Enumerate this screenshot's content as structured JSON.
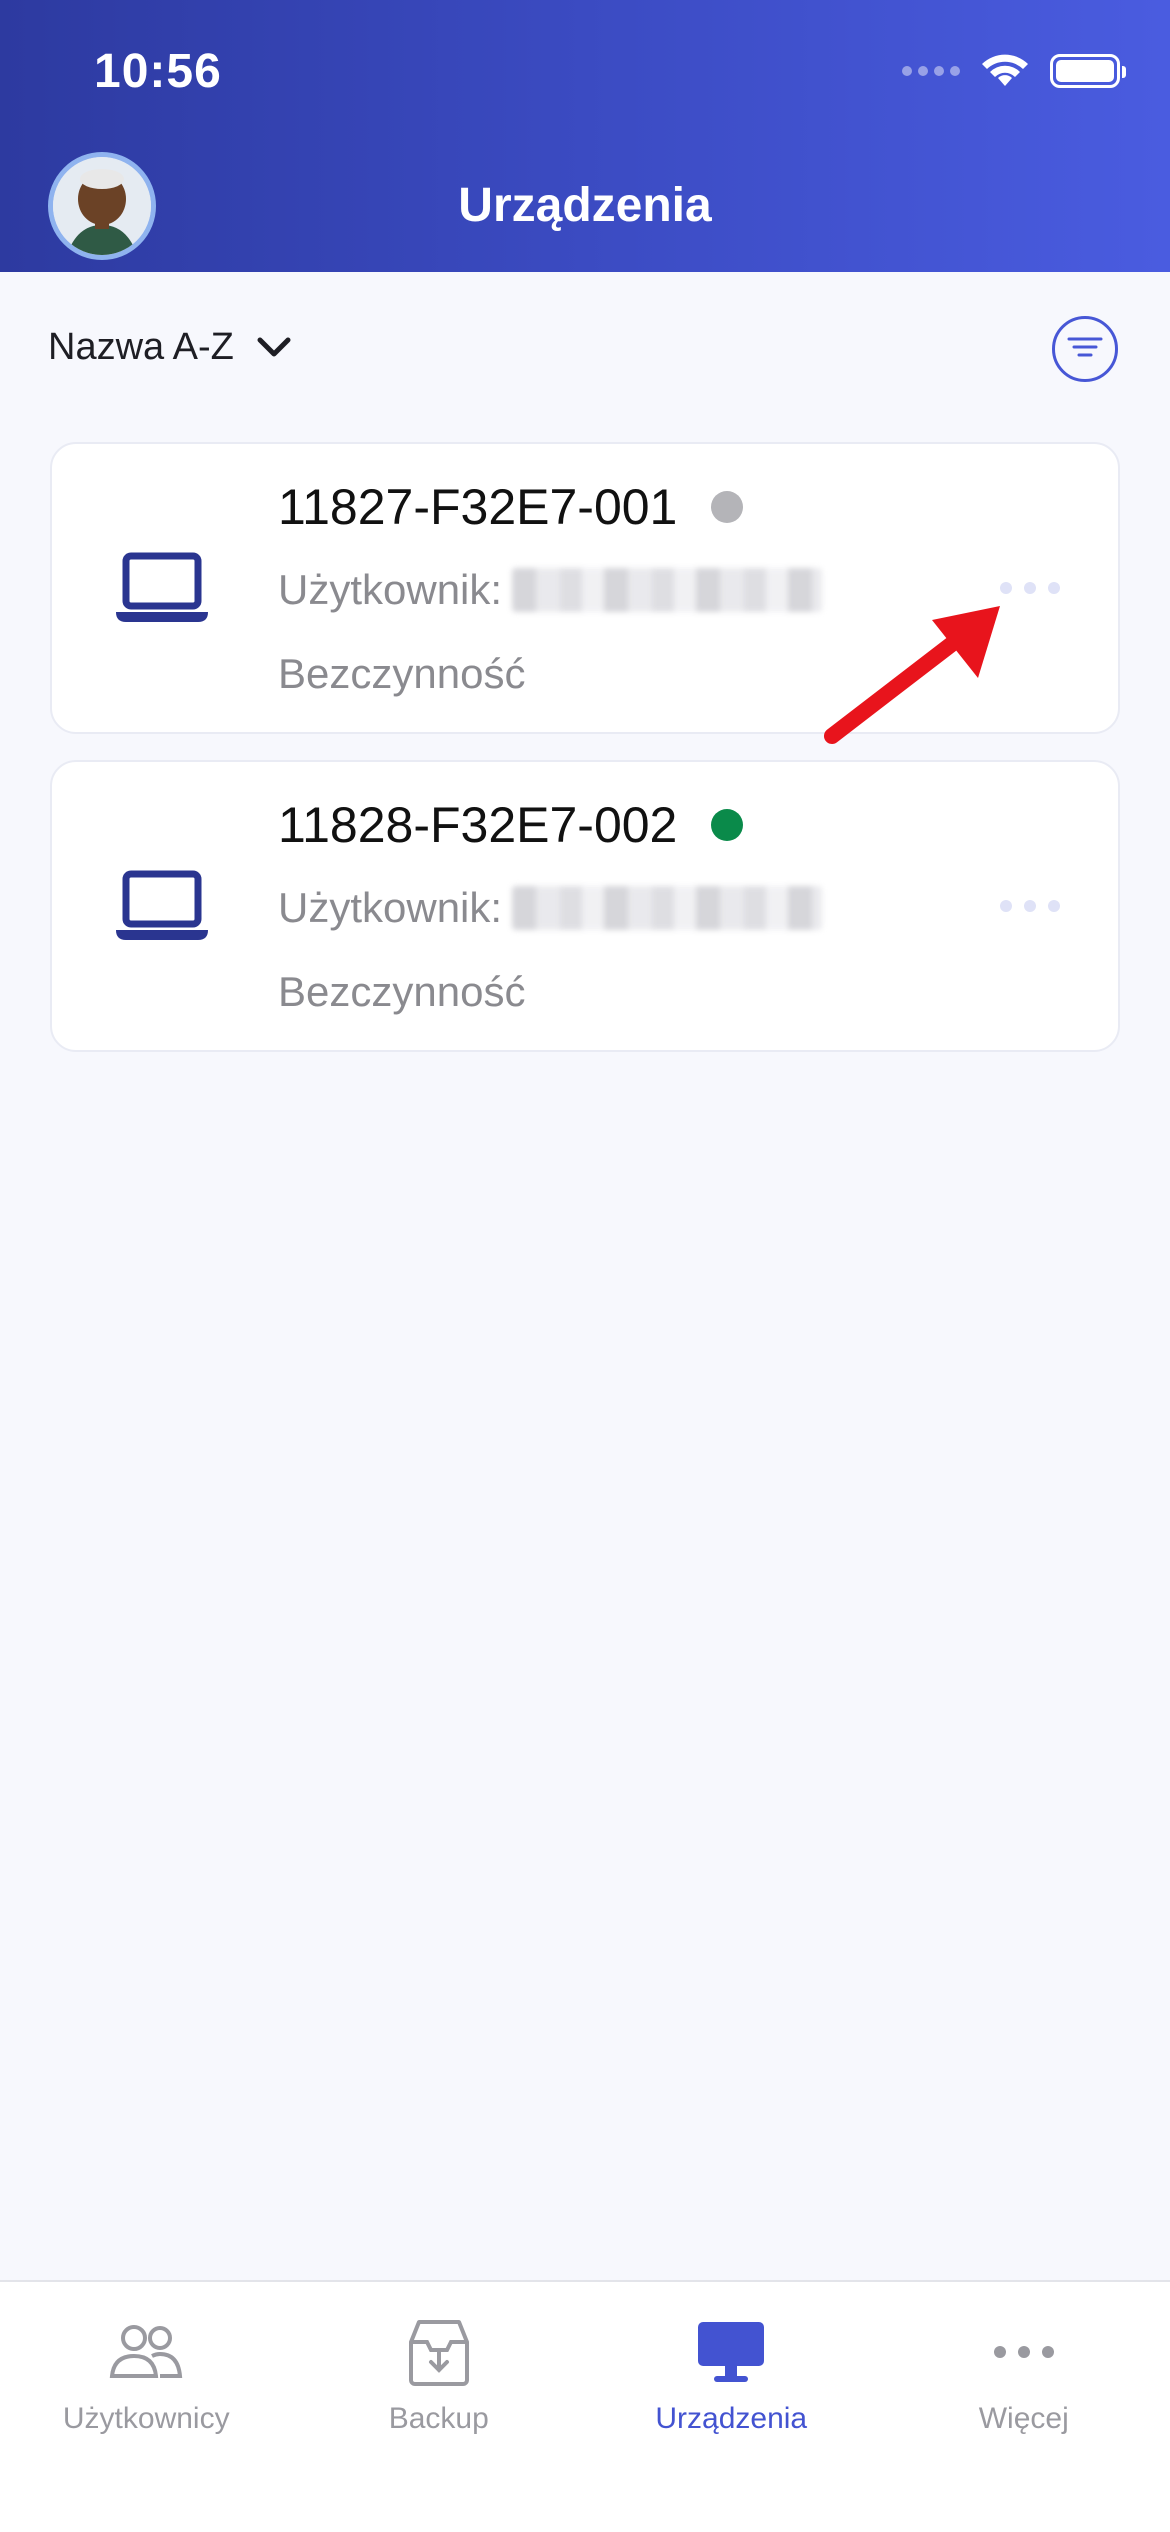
{
  "status_bar": {
    "time": "10:56"
  },
  "header": {
    "title": "Urządzenia"
  },
  "sort": {
    "label": "Nazwa A-Z"
  },
  "devices": [
    {
      "name": "11827-F32E7-001",
      "user_label": "Użytkownik:",
      "state": "Bezczynność",
      "status_color": "#b4b4b8"
    },
    {
      "name": "11828-F32E7-002",
      "user_label": "Użytkownik:",
      "state": "Bezczynność",
      "status_color": "#0a8a4a"
    }
  ],
  "bottom_nav": {
    "tabs": [
      {
        "label": "Użytkownicy",
        "icon": "users-icon"
      },
      {
        "label": "Backup",
        "icon": "archive-box-icon"
      },
      {
        "label": "Urządzenia",
        "icon": "monitor-icon",
        "active": true
      },
      {
        "label": "Więcej",
        "icon": "more-icon"
      }
    ]
  },
  "colors": {
    "accent": "#4353d1",
    "header_start": "#2d3aa0",
    "header_end": "#4a5ce0",
    "annotation_arrow": "#e8141c"
  }
}
